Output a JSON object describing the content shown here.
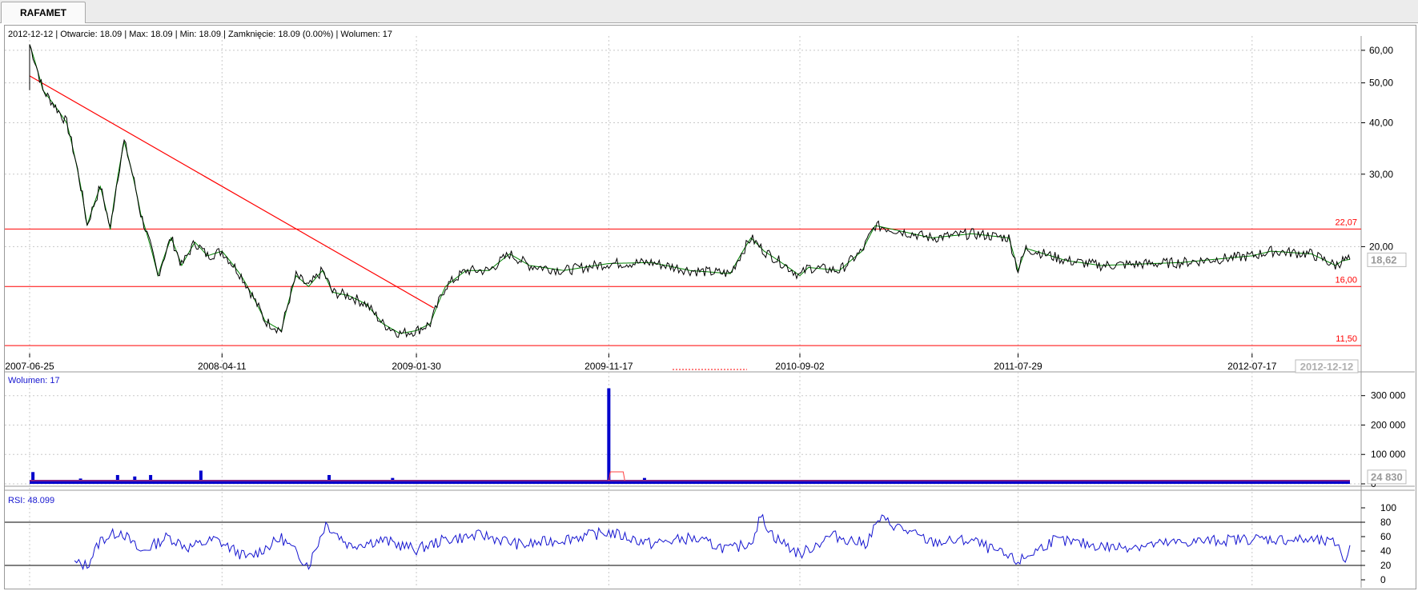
{
  "tab": {
    "label": "RAFAMET"
  },
  "info_line": "2012-12-12 | Otwarcie: 18.09 | Max: 18.09 | Min: 18.09 | Zamknięcie: 18.09 (0.00%)  | Wolumen: 17",
  "volume_label": "Wolumen: 17",
  "rsi_label": "RSI: 48.099",
  "colors": {
    "price": "#000000",
    "ma": "#008000",
    "lines": "#ff0000",
    "volume": "#0000cc",
    "rsi": "#1515d0",
    "grid": "#c8c8c8"
  },
  "chart_data": [
    {
      "type": "line",
      "name": "price",
      "log_scale": true,
      "ylim": [
        11,
        65
      ],
      "yticks": [
        {
          "v": 60,
          "label": "60,00"
        },
        {
          "v": 50,
          "label": "50,00"
        },
        {
          "v": 40,
          "label": "40,00"
        },
        {
          "v": 30,
          "label": "30,00"
        },
        {
          "v": 20,
          "label": "20,00"
        }
      ],
      "xticks": [
        "2007-06-25",
        "2008-04-11",
        "2009-01-30",
        "2009-11-17",
        "2010-09-02",
        "2011-07-29",
        "2012-07-17"
      ],
      "x_last_label": "2012-12-12",
      "last_value_label": "18,62",
      "x": [
        "2007-06-25",
        "2007-07-15",
        "2007-08-20",
        "2007-09-20",
        "2007-10-10",
        "2007-10-25",
        "2007-11-15",
        "2007-12-10",
        "2008-01-05",
        "2008-01-25",
        "2008-02-10",
        "2008-03-01",
        "2008-03-20",
        "2008-04-11",
        "2008-05-10",
        "2008-06-15",
        "2008-07-10",
        "2008-08-01",
        "2008-08-20",
        "2008-09-10",
        "2008-09-25",
        "2008-10-20",
        "2008-11-15",
        "2008-12-10",
        "2009-01-05",
        "2009-01-30",
        "2009-02-20",
        "2009-03-15",
        "2009-04-15",
        "2009-05-20",
        "2009-06-20",
        "2009-07-20",
        "2009-09-10",
        "2009-11-17",
        "2010-01-20",
        "2010-03-20",
        "2010-05-20",
        "2010-06-20",
        "2010-07-10",
        "2010-09-02",
        "2010-09-15",
        "2010-11-01",
        "2010-12-05",
        "2010-12-25",
        "2011-03-20",
        "2011-05-20",
        "2011-07-15",
        "2011-07-29",
        "2011-08-10",
        "2011-10-10",
        "2011-12-01",
        "2012-04-01",
        "2012-07-17",
        "2012-08-15",
        "2012-10-15",
        "2012-11-20",
        "2012-12-01",
        "2012-12-12"
      ],
      "y": [
        62,
        48,
        40,
        22.5,
        28,
        22,
        36,
        24,
        17,
        21,
        18,
        20.5,
        19,
        19.5,
        17,
        13.2,
        12.5,
        17,
        16,
        17.5,
        15.5,
        15.2,
        14.5,
        13,
        12.3,
        12.5,
        13,
        16,
        17.5,
        17.5,
        19.2,
        18,
        17.5,
        18.2,
        18.3,
        17.5,
        17.2,
        21,
        19.5,
        17,
        17.8,
        17.5,
        19.5,
        22.5,
        21,
        21.5,
        21,
        17.5,
        19.8,
        18.5,
        18,
        18.3,
        19,
        19.5,
        19.2,
        18,
        18.5,
        18.62
      ],
      "hlines": [
        {
          "v": 22.07,
          "label": "22,07"
        },
        {
          "v": 16.0,
          "label": "16,00"
        },
        {
          "v": 11.5,
          "label": "11,50"
        }
      ],
      "trendline": {
        "x1": "2007-06-25",
        "y1": 52,
        "x2": "2009-02-25",
        "y2": 14.2
      }
    },
    {
      "type": "bar",
      "name": "Wolumen",
      "ylim": [
        0,
        340000
      ],
      "yticks": [
        {
          "v": 0,
          "label": "0"
        },
        {
          "v": 100000,
          "label": "100 000"
        },
        {
          "v": 200000,
          "label": "200 000"
        },
        {
          "v": 300000,
          "label": "300 000"
        }
      ],
      "last_value_label": "24 830",
      "spikes": [
        {
          "x": "2007-06-30",
          "v": 40000
        },
        {
          "x": "2007-09-10",
          "v": 18000
        },
        {
          "x": "2007-11-05",
          "v": 30000
        },
        {
          "x": "2007-12-01",
          "v": 25000
        },
        {
          "x": "2007-12-25",
          "v": 30000
        },
        {
          "x": "2008-03-10",
          "v": 45000
        },
        {
          "x": "2008-09-20",
          "v": 30000
        },
        {
          "x": "2008-12-25",
          "v": 20000
        },
        {
          "x": "2009-11-17",
          "v": 325000
        },
        {
          "x": "2010-01-10",
          "v": 20000
        },
        {
          "x": "2011-03-25",
          "v": 12000
        }
      ]
    },
    {
      "type": "line",
      "name": "RSI",
      "ylim": [
        0,
        100
      ],
      "yticks": [
        {
          "v": 0,
          "label": "0"
        },
        {
          "v": 20,
          "label": "20"
        },
        {
          "v": 40,
          "label": "40"
        },
        {
          "v": 60,
          "label": "60"
        },
        {
          "v": 80,
          "label": "80"
        },
        {
          "v": 100,
          "label": "100"
        }
      ],
      "hlines": [
        20,
        80
      ],
      "x": [
        "2007-09-01",
        "2007-09-20",
        "2007-10-10",
        "2007-11-10",
        "2007-12-10",
        "2008-01-20",
        "2008-02-20",
        "2008-04-01",
        "2008-05-20",
        "2008-07-10",
        "2008-08-20",
        "2008-09-15",
        "2008-10-20",
        "2008-12-10",
        "2009-01-30",
        "2009-03-15",
        "2009-05-10",
        "2009-07-10",
        "2009-09-20",
        "2009-11-17",
        "2010-01-20",
        "2010-03-20",
        "2010-05-20",
        "2010-06-20",
        "2010-07-05",
        "2010-07-25",
        "2010-09-02",
        "2010-10-20",
        "2010-12-10",
        "2011-01-01",
        "2011-03-20",
        "2011-05-20",
        "2011-07-29",
        "2011-09-20",
        "2011-12-20",
        "2012-04-20",
        "2012-07-17",
        "2012-10-15",
        "2012-11-25",
        "2012-12-05",
        "2012-12-12"
      ],
      "y": [
        23,
        20,
        55,
        68,
        38,
        60,
        45,
        56,
        30,
        58,
        20,
        78,
        48,
        55,
        42,
        56,
        62,
        48,
        58,
        66,
        50,
        58,
        42,
        52,
        88,
        60,
        35,
        62,
        50,
        85,
        52,
        55,
        25,
        55,
        45,
        53,
        57,
        55,
        50,
        20,
        48
      ]
    }
  ]
}
